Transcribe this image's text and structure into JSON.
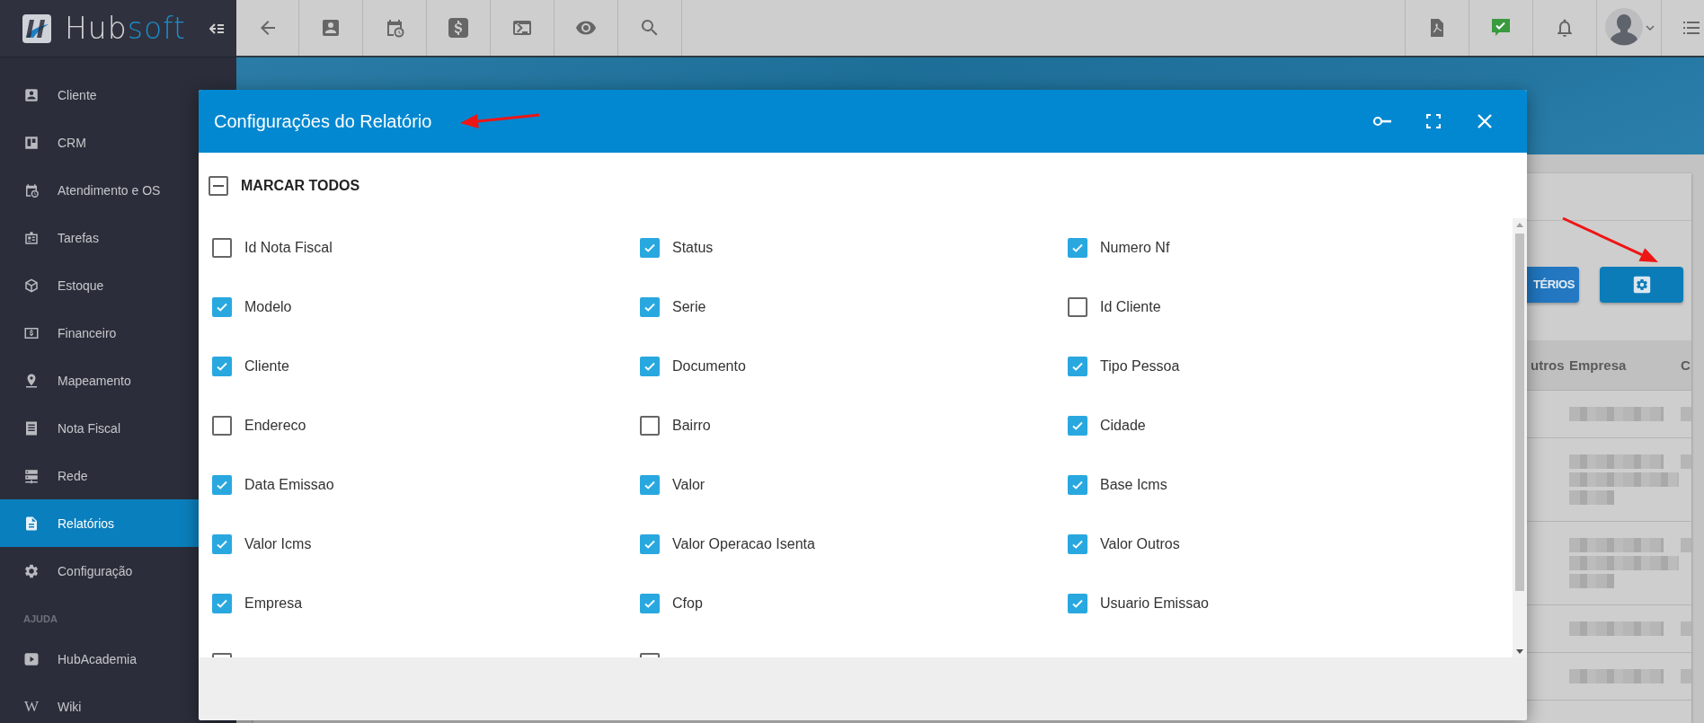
{
  "logo": {
    "name": "Hub",
    "name_accent": "soft"
  },
  "topbar": {
    "left": [
      {
        "kind": "back"
      },
      {
        "kind": "contact"
      },
      {
        "kind": "calendar"
      },
      {
        "kind": "dollar"
      },
      {
        "kind": "terminal"
      },
      {
        "kind": "eye"
      },
      {
        "kind": "search"
      }
    ],
    "right": [
      {
        "kind": "pdf"
      },
      {
        "kind": "chat"
      },
      {
        "kind": "bell"
      },
      {
        "kind": "avatar"
      },
      {
        "kind": "list"
      }
    ]
  },
  "sidebar": {
    "sections": [
      {
        "items": [
          {
            "label": "Cliente",
            "kind": "contact",
            "selected": false
          },
          {
            "label": "CRM",
            "kind": "board",
            "selected": false
          },
          {
            "label": "Atendimento e OS",
            "kind": "calendar",
            "selected": false
          },
          {
            "label": "Tarefas",
            "kind": "badge",
            "selected": false
          },
          {
            "label": "Estoque",
            "kind": "cube",
            "selected": false
          },
          {
            "label": "Financeiro",
            "kind": "money",
            "selected": false
          },
          {
            "label": "Mapeamento",
            "kind": "pin",
            "selected": false
          },
          {
            "label": "Nota Fiscal",
            "kind": "receipt",
            "selected": false
          },
          {
            "label": "Rede",
            "kind": "server",
            "selected": false
          },
          {
            "label": "Relatórios",
            "kind": "doc",
            "selected": true
          },
          {
            "label": "Configuração",
            "kind": "gear",
            "selected": false
          }
        ]
      },
      {
        "title": "AJUDA",
        "items": [
          {
            "label": "HubAcademia",
            "kind": "play",
            "selected": false
          },
          {
            "label": "Wiki",
            "icon_char": "W",
            "selected": false
          }
        ]
      }
    ]
  },
  "background": {
    "buttons": [
      {
        "kind": "text",
        "label": "TÉRIOS"
      },
      {
        "kind": "settings"
      }
    ],
    "columns": [
      "utros",
      "Empresa",
      "C"
    ],
    "rows": [
      {
        "kind": "redacted"
      },
      {
        "kind": "redacted_tall"
      },
      {
        "kind": "redacted_tall"
      },
      {
        "kind": "redacted"
      },
      {
        "kind": "redacted"
      }
    ]
  },
  "modal": {
    "title": "Configurações do Relatório",
    "select_all": {
      "label": "MARCAR TODOS",
      "indeterminate": true
    },
    "fields": [
      {
        "label": "Id Nota Fiscal",
        "checked": false
      },
      {
        "label": "Status",
        "checked": true
      },
      {
        "label": "Numero Nf",
        "checked": true
      },
      {
        "label": "Modelo",
        "checked": true
      },
      {
        "label": "Serie",
        "checked": true
      },
      {
        "label": "Id Cliente",
        "checked": false
      },
      {
        "label": "Cliente",
        "checked": true
      },
      {
        "label": "Documento",
        "checked": true
      },
      {
        "label": "Tipo Pessoa",
        "checked": true
      },
      {
        "label": "Endereco",
        "checked": false
      },
      {
        "label": "Bairro",
        "checked": false
      },
      {
        "label": "Cidade",
        "checked": true
      },
      {
        "label": "Data Emissao",
        "checked": true
      },
      {
        "label": "Valor",
        "checked": true
      },
      {
        "label": "Base Icms",
        "checked": true
      },
      {
        "label": "Valor Icms",
        "checked": true
      },
      {
        "label": "Valor Operacao Isenta",
        "checked": true
      },
      {
        "label": "Valor Outros",
        "checked": true
      },
      {
        "label": "Empresa",
        "checked": true
      },
      {
        "label": "Cfop",
        "checked": true
      },
      {
        "label": "Usuario Emissao",
        "checked": true
      },
      {
        "checked": false
      },
      {
        "checked": false
      }
    ]
  },
  "annotations": [
    {
      "kind": "arrow"
    },
    {
      "kind": "arrow"
    }
  ]
}
